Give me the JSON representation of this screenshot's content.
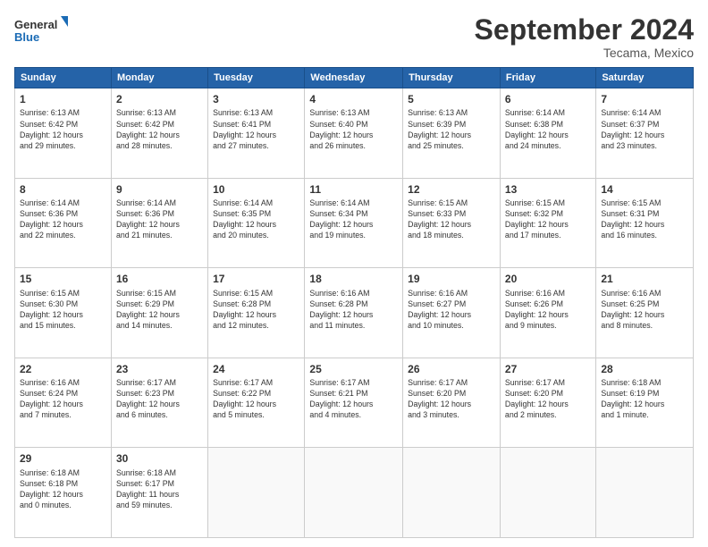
{
  "logo": {
    "line1": "General",
    "line2": "Blue"
  },
  "title": "September 2024",
  "subtitle": "Tecama, Mexico",
  "header_days": [
    "Sunday",
    "Monday",
    "Tuesday",
    "Wednesday",
    "Thursday",
    "Friday",
    "Saturday"
  ],
  "weeks": [
    [
      {
        "day": "1",
        "info": "Sunrise: 6:13 AM\nSunset: 6:42 PM\nDaylight: 12 hours\nand 29 minutes."
      },
      {
        "day": "2",
        "info": "Sunrise: 6:13 AM\nSunset: 6:42 PM\nDaylight: 12 hours\nand 28 minutes."
      },
      {
        "day": "3",
        "info": "Sunrise: 6:13 AM\nSunset: 6:41 PM\nDaylight: 12 hours\nand 27 minutes."
      },
      {
        "day": "4",
        "info": "Sunrise: 6:13 AM\nSunset: 6:40 PM\nDaylight: 12 hours\nand 26 minutes."
      },
      {
        "day": "5",
        "info": "Sunrise: 6:13 AM\nSunset: 6:39 PM\nDaylight: 12 hours\nand 25 minutes."
      },
      {
        "day": "6",
        "info": "Sunrise: 6:14 AM\nSunset: 6:38 PM\nDaylight: 12 hours\nand 24 minutes."
      },
      {
        "day": "7",
        "info": "Sunrise: 6:14 AM\nSunset: 6:37 PM\nDaylight: 12 hours\nand 23 minutes."
      }
    ],
    [
      {
        "day": "8",
        "info": "Sunrise: 6:14 AM\nSunset: 6:36 PM\nDaylight: 12 hours\nand 22 minutes."
      },
      {
        "day": "9",
        "info": "Sunrise: 6:14 AM\nSunset: 6:36 PM\nDaylight: 12 hours\nand 21 minutes."
      },
      {
        "day": "10",
        "info": "Sunrise: 6:14 AM\nSunset: 6:35 PM\nDaylight: 12 hours\nand 20 minutes."
      },
      {
        "day": "11",
        "info": "Sunrise: 6:14 AM\nSunset: 6:34 PM\nDaylight: 12 hours\nand 19 minutes."
      },
      {
        "day": "12",
        "info": "Sunrise: 6:15 AM\nSunset: 6:33 PM\nDaylight: 12 hours\nand 18 minutes."
      },
      {
        "day": "13",
        "info": "Sunrise: 6:15 AM\nSunset: 6:32 PM\nDaylight: 12 hours\nand 17 minutes."
      },
      {
        "day": "14",
        "info": "Sunrise: 6:15 AM\nSunset: 6:31 PM\nDaylight: 12 hours\nand 16 minutes."
      }
    ],
    [
      {
        "day": "15",
        "info": "Sunrise: 6:15 AM\nSunset: 6:30 PM\nDaylight: 12 hours\nand 15 minutes."
      },
      {
        "day": "16",
        "info": "Sunrise: 6:15 AM\nSunset: 6:29 PM\nDaylight: 12 hours\nand 14 minutes."
      },
      {
        "day": "17",
        "info": "Sunrise: 6:15 AM\nSunset: 6:28 PM\nDaylight: 12 hours\nand 12 minutes."
      },
      {
        "day": "18",
        "info": "Sunrise: 6:16 AM\nSunset: 6:28 PM\nDaylight: 12 hours\nand 11 minutes."
      },
      {
        "day": "19",
        "info": "Sunrise: 6:16 AM\nSunset: 6:27 PM\nDaylight: 12 hours\nand 10 minutes."
      },
      {
        "day": "20",
        "info": "Sunrise: 6:16 AM\nSunset: 6:26 PM\nDaylight: 12 hours\nand 9 minutes."
      },
      {
        "day": "21",
        "info": "Sunrise: 6:16 AM\nSunset: 6:25 PM\nDaylight: 12 hours\nand 8 minutes."
      }
    ],
    [
      {
        "day": "22",
        "info": "Sunrise: 6:16 AM\nSunset: 6:24 PM\nDaylight: 12 hours\nand 7 minutes."
      },
      {
        "day": "23",
        "info": "Sunrise: 6:17 AM\nSunset: 6:23 PM\nDaylight: 12 hours\nand 6 minutes."
      },
      {
        "day": "24",
        "info": "Sunrise: 6:17 AM\nSunset: 6:22 PM\nDaylight: 12 hours\nand 5 minutes."
      },
      {
        "day": "25",
        "info": "Sunrise: 6:17 AM\nSunset: 6:21 PM\nDaylight: 12 hours\nand 4 minutes."
      },
      {
        "day": "26",
        "info": "Sunrise: 6:17 AM\nSunset: 6:20 PM\nDaylight: 12 hours\nand 3 minutes."
      },
      {
        "day": "27",
        "info": "Sunrise: 6:17 AM\nSunset: 6:20 PM\nDaylight: 12 hours\nand 2 minutes."
      },
      {
        "day": "28",
        "info": "Sunrise: 6:18 AM\nSunset: 6:19 PM\nDaylight: 12 hours\nand 1 minute."
      }
    ],
    [
      {
        "day": "29",
        "info": "Sunrise: 6:18 AM\nSunset: 6:18 PM\nDaylight: 12 hours\nand 0 minutes."
      },
      {
        "day": "30",
        "info": "Sunrise: 6:18 AM\nSunset: 6:17 PM\nDaylight: 11 hours\nand 59 minutes."
      },
      {
        "day": "",
        "info": ""
      },
      {
        "day": "",
        "info": ""
      },
      {
        "day": "",
        "info": ""
      },
      {
        "day": "",
        "info": ""
      },
      {
        "day": "",
        "info": ""
      }
    ]
  ]
}
